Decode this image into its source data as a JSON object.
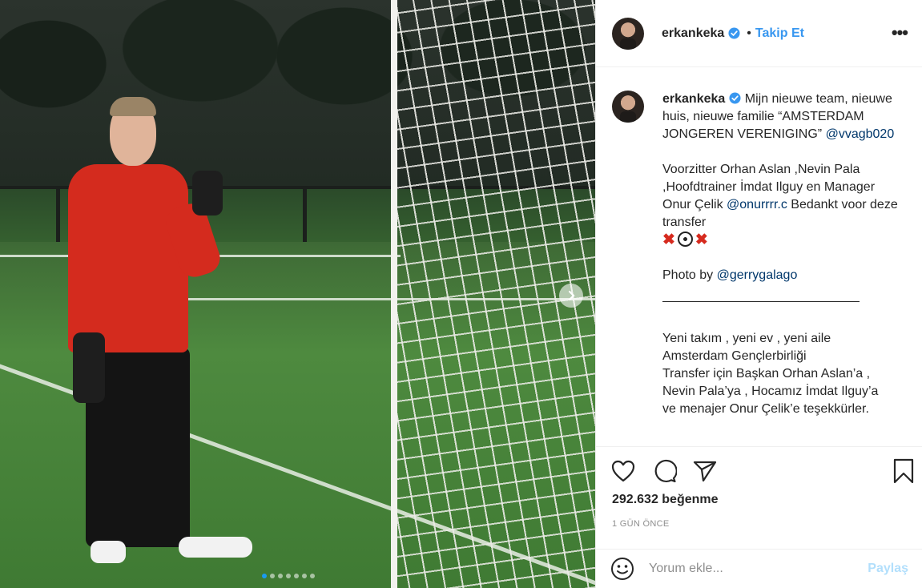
{
  "post": {
    "username": "erkankeka",
    "follow_label": "Takip Et",
    "separator": "•",
    "more_label": "•••",
    "photo_count": 7,
    "active_photo_index": 1
  },
  "caption": {
    "username": "erkankeka",
    "line1": "Mijn nieuwe team, nieuwe huis, nieuwe familie “AMSTERDAM JONGEREN VERENIGING” ",
    "mention1": "@vvagb020",
    "line2": "Voorzitter Orhan Aslan ,Nevin Pala ,Hoofdtrainer İmdat Ilguy en Manager Onur Çelik ",
    "mention2": "@onurrrr.c",
    "line2_end": " Bedankt voor deze transfer",
    "emoji_x": "✖",
    "photo_by": "Photo by ",
    "mention3": "@gerrygalago",
    "tr_line1": "Yeni takım , yeni ev , yeni aile",
    "tr_line2": "Amsterdam Gençlerbirliği",
    "tr_line3": "Transfer için Başkan Orhan Aslan’a ,",
    "tr_line4": "Nevin Pala’ya , Hocamız İmdat Ilguy’a",
    "tr_line5": "ve menajer Onur Çelik’e teşekkürler."
  },
  "engagement": {
    "likes": "292.632 beğenme",
    "time": "1 GÜN ÖNCE"
  },
  "comment": {
    "placeholder": "Yorum ekle...",
    "share_label": "Paylaş"
  },
  "colors": {
    "link_blue": "#3897f0",
    "mention_blue": "#00376b",
    "share_disabled": "#b2dffc",
    "dot_active": "#1a9bf0"
  }
}
